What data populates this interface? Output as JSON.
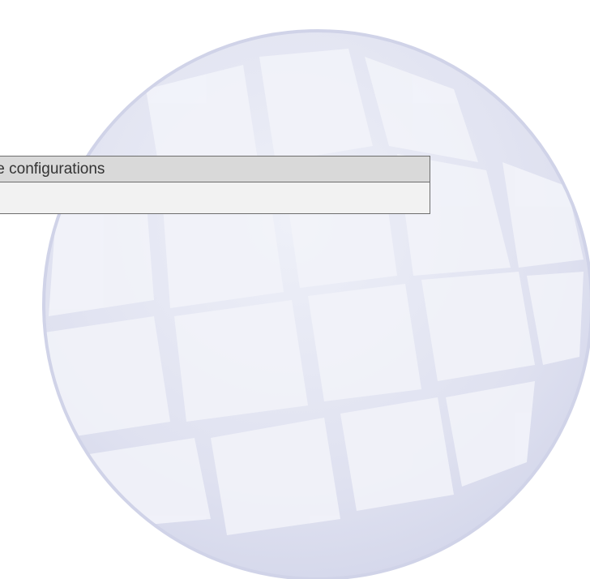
{
  "background": {
    "icon": "globe-icon",
    "color": "#dcdcef"
  },
  "panel": {
    "header_label": "te configurations",
    "row_value": ""
  }
}
